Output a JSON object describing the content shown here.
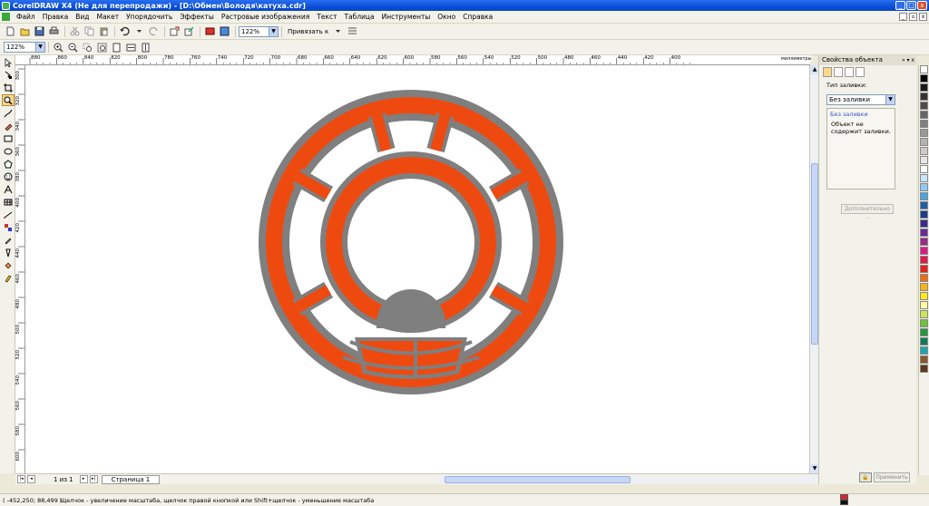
{
  "window": {
    "title": "CorelDRAW X4 (Не для перепродажи) - [D:\\Обмен\\Володя\\катуха.cdr]"
  },
  "menu": {
    "items": [
      "Файл",
      "Правка",
      "Вид",
      "Макет",
      "Упорядочить",
      "Эффекты",
      "Растровые изображения",
      "Текст",
      "Таблица",
      "Инструменты",
      "Окно",
      "Справка"
    ]
  },
  "toolbar": {
    "zoom_value": "122%",
    "snap_label": "Привязать к"
  },
  "toolbar2": {
    "zoom_value": "122%"
  },
  "ruler": {
    "top_labels": [
      "880",
      "860",
      "840",
      "820",
      "800",
      "780",
      "760",
      "740",
      "720",
      "700",
      "680",
      "660",
      "640",
      "620",
      "600",
      "580",
      "560",
      "540",
      "520",
      "500",
      "480",
      "460",
      "440",
      "420",
      "400"
    ],
    "units": "миллиметры",
    "left_labels": [
      "300",
      "320",
      "340",
      "360",
      "380",
      "400",
      "420",
      "440",
      "460",
      "480",
      "500",
      "520",
      "540",
      "560",
      "580",
      "600"
    ]
  },
  "page_nav": {
    "count": "1 из 1",
    "page_name": "Страница 1"
  },
  "docker": {
    "title": "Свойства объекта",
    "fill_type_label": "Тип заливки:",
    "fill_type_value": "Без заливки",
    "panel_heading": "Без заливки",
    "panel_desc": "Объект не содержит заливки.",
    "more_button": "Дополнительно ...",
    "apply_button": "Применить"
  },
  "status": {
    "coords": "( -452,250; 88,499 )",
    "hint": "Щелчок - увеличение масштаба, щелчок правой кнопкой или Shift+щелчок - уменьшение масштаба"
  },
  "colors": {
    "orange": "#ee4a10",
    "gray": "#7f7f7f",
    "palette": [
      "#ffffff",
      "#000000",
      "#1a1a1a",
      "#333333",
      "#4d4d4d",
      "#666666",
      "#808080",
      "#999999",
      "#b3b3b3",
      "#cccccc",
      "#e6e6e6",
      "#ffffff",
      "#c6e6ff",
      "#8ecbf0",
      "#4aa6e0",
      "#1f5fa8",
      "#1d3a8c",
      "#3a2a8c",
      "#6a2a98",
      "#9a2a8c",
      "#e0198a",
      "#e8144a",
      "#e8201e",
      "#f06a10",
      "#f7b21c",
      "#ffe81a",
      "#fff8a0",
      "#c8e650",
      "#6ec23a",
      "#1f9a3a",
      "#0f7a5a",
      "#1aa8b0",
      "#8a5a2a",
      "#5a3a1a"
    ]
  }
}
